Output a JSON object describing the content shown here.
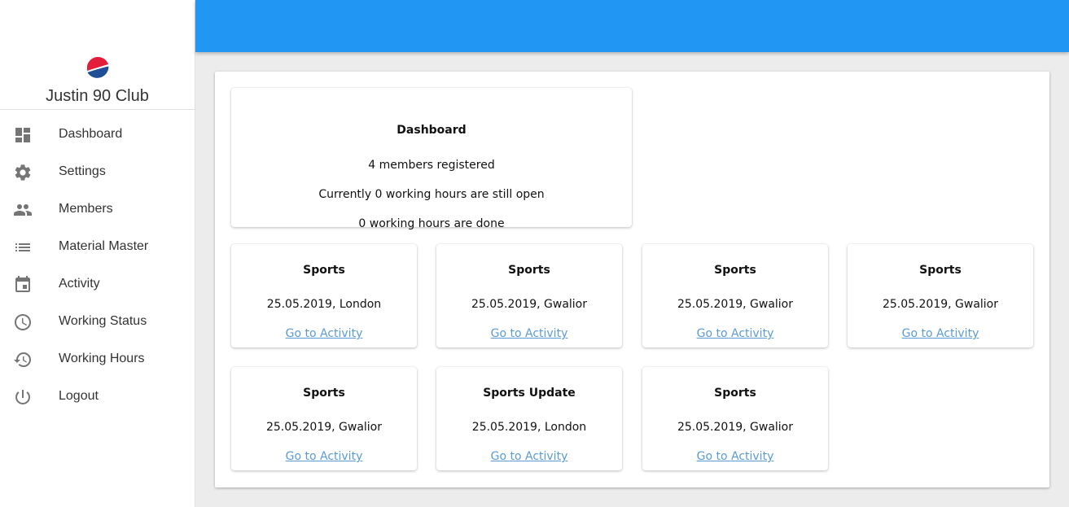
{
  "brand": {
    "name": "Justin 90 Club",
    "logo": "pepsi-globe-logo"
  },
  "sidebar": {
    "items": [
      {
        "label": "Dashboard",
        "icon": "dashboard-icon"
      },
      {
        "label": "Settings",
        "icon": "gear-icon"
      },
      {
        "label": "Members",
        "icon": "people-icon"
      },
      {
        "label": "Material Master",
        "icon": "list-icon"
      },
      {
        "label": "Activity",
        "icon": "calendar-icon"
      },
      {
        "label": "Working Status",
        "icon": "clock-icon"
      },
      {
        "label": "Working Hours",
        "icon": "history-icon"
      },
      {
        "label": "Logout",
        "icon": "power-icon"
      }
    ]
  },
  "topbar": {
    "color": "#2196f3"
  },
  "summary": {
    "title": "Dashboard",
    "members": "4 members registered",
    "open_hours": "Currently 0 working hours are still open",
    "done_hours": "0 working hours are done"
  },
  "activities": [
    {
      "title": "Sports",
      "meta": "25.05.2019, London",
      "link": "Go to Activity"
    },
    {
      "title": "Sports",
      "meta": "25.05.2019, Gwalior",
      "link": "Go to Activity"
    },
    {
      "title": "Sports",
      "meta": "25.05.2019, Gwalior",
      "link": "Go to Activity"
    },
    {
      "title": "Sports",
      "meta": "25.05.2019, Gwalior",
      "link": "Go to Activity"
    },
    {
      "title": "Sports",
      "meta": "25.05.2019, Gwalior",
      "link": "Go to Activity"
    },
    {
      "title": "Sports Update",
      "meta": "25.05.2019, London",
      "link": "Go to Activity"
    },
    {
      "title": "Sports",
      "meta": "25.05.2019, Gwalior",
      "link": "Go to Activity"
    }
  ],
  "colors": {
    "link": "#5b9bd5",
    "icon": "#757575"
  }
}
